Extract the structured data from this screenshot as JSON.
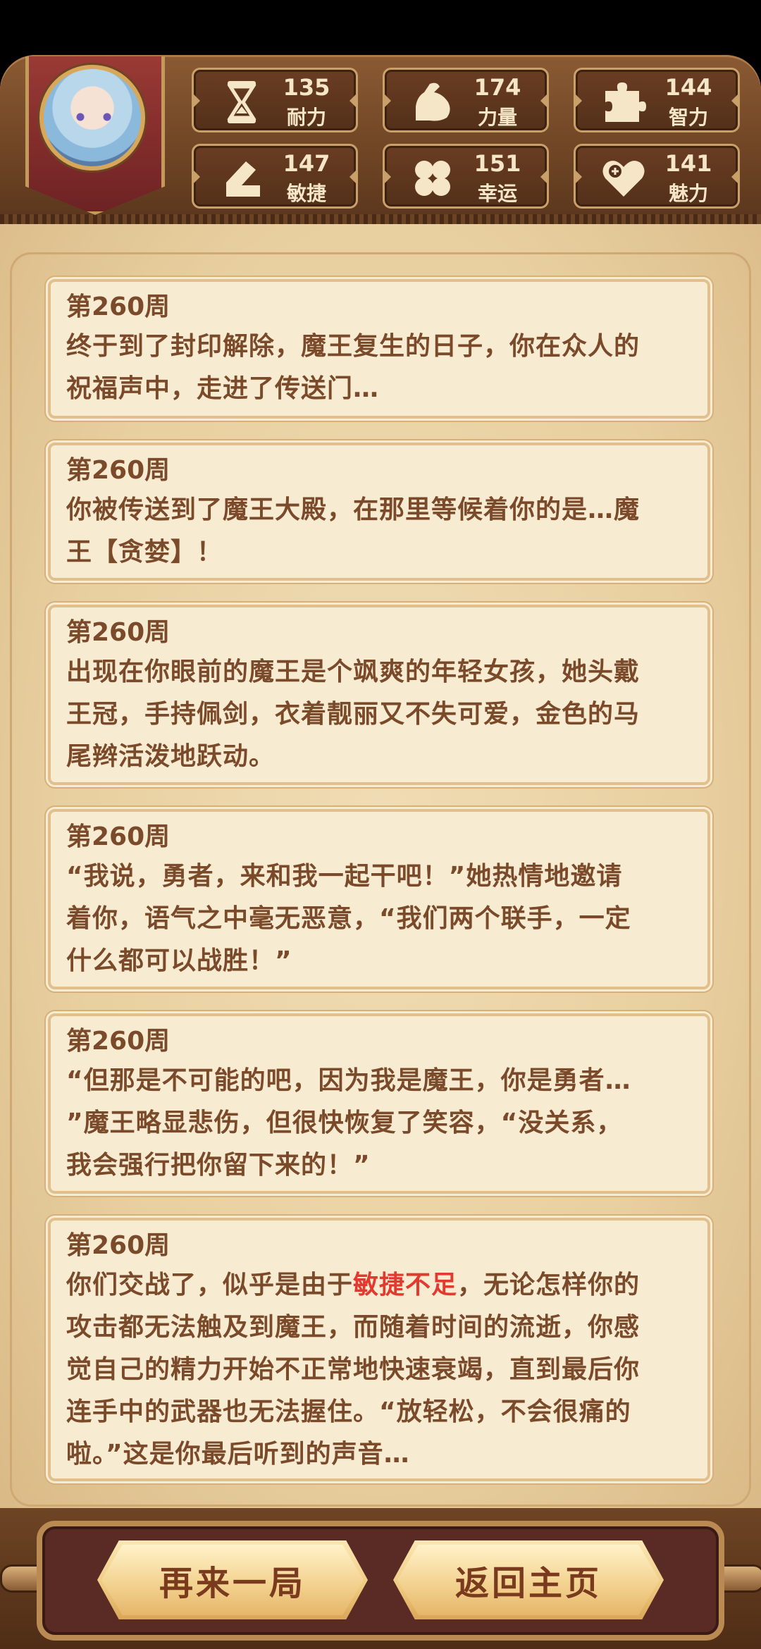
{
  "stats": [
    {
      "icon": "hourglass-icon",
      "value": "135",
      "label": "耐力"
    },
    {
      "icon": "flexed-arm-icon",
      "value": "174",
      "label": "力量"
    },
    {
      "icon": "puzzle-icon",
      "value": "144",
      "label": "智力"
    },
    {
      "icon": "boot-icon",
      "value": "147",
      "label": "敏捷"
    },
    {
      "icon": "clover-icon",
      "value": "151",
      "label": "幸运"
    },
    {
      "icon": "heart-plus-icon",
      "value": "141",
      "label": "魅力"
    }
  ],
  "log": [
    {
      "week": "第260周",
      "lines": [
        "终于到了封印解除，魔王复生的日子，你在众人的",
        "祝福声中，走进了传送门…"
      ]
    },
    {
      "week": "第260周",
      "lines": [
        "你被传送到了魔王大殿，在那里等候着你的是…魔",
        "王【贪婪】！"
      ]
    },
    {
      "week": "第260周",
      "lines": [
        "出现在你眼前的魔王是个飒爽的年轻女孩，她头戴",
        "王冠，手持佩剑，衣着靓丽又不失可爱，金色的马",
        "尾辫活泼地跃动。"
      ]
    },
    {
      "week": "第260周",
      "lines": [
        "“我说，勇者，来和我一起干吧！”她热情地邀请",
        "着你，语气之中毫无恶意，“我们两个联手，一定",
        "什么都可以战胜！”"
      ]
    },
    {
      "week": "第260周",
      "lines": [
        "“但那是不可能的吧，因为我是魔王，你是勇者…",
        "”魔王略显悲伤，但很快恢复了笑容，“没关系，",
        "我会强行把你留下来的！”"
      ]
    },
    {
      "week": "第260周",
      "line1_pre": "你们交战了，似乎是由于",
      "line1_red": "敏捷不足",
      "line1_post": "，无论怎样你的",
      "lines": [
        "攻击都无法触及到魔王，而随着时间的流逝，你感",
        "觉自己的精力开始不正常地快速衰竭，直到最后你",
        "连手中的武器也无法握住。“放轻松，不会很痛的",
        "啦。”这是你最后听到的声音…"
      ]
    }
  ],
  "buttons": {
    "retry": "再来一局",
    "home": "返回主页"
  },
  "colors": {
    "highlight": "#e23a2e",
    "text": "#7a4a2a"
  }
}
